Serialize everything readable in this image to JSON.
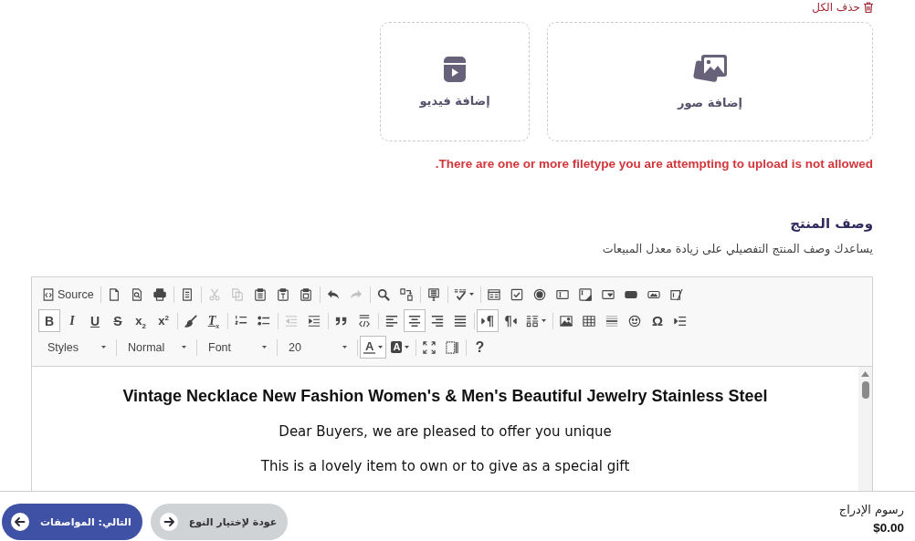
{
  "delete_all": {
    "label": "حذف الكل"
  },
  "upload": {
    "tiles": [
      {
        "kind": "images",
        "label": "إضافة صور"
      },
      {
        "kind": "video",
        "label": "إضافة فيديو"
      }
    ],
    "error": "There are one or more filetype you are attempting to upload is not allowed."
  },
  "description": {
    "title": "وصف المنتج",
    "hint": "يساعدك وصف المنتج التفصيلي على زيادة معدل المبيعات"
  },
  "editor": {
    "toolbar": [
      [
        [
          {
            "kind": "icon",
            "on": false,
            "disabled": false
          },
          {
            "kind": "icon",
            "on": false,
            "disabled": false
          },
          {
            "kind": "icon",
            "on": false,
            "disabled": false
          },
          {
            "kind": "icon",
            "on": false,
            "disabled": false
          },
          {
            "kind": "icon",
            "on": false,
            "disabled": false
          },
          {
            "kind": "icon",
            "on": false,
            "disabled": false
          },
          {
            "kind": "icon",
            "on": false,
            "disabled": false
          },
          {
            "kind": "icon",
            "on": false,
            "disabled": false
          },
          {
            "kind": "icon",
            "on": false,
            "disabled": false
          }
        ],
        [
          {
            "kind": "menu",
            "on": false,
            "disabled": false
          }
        ],
        [
          {
            "kind": "icon",
            "on": false,
            "disabled": false
          }
        ],
        [
          {
            "kind": "icon",
            "on": false,
            "disabled": false
          },
          {
            "kind": "icon",
            "on": false,
            "disabled": false
          }
        ],
        [
          {
            "kind": "icon",
            "on": false,
            "disabled": true
          },
          {
            "kind": "icon",
            "on": false,
            "disabled": false
          }
        ],
        [
          {
            "kind": "icon",
            "on": false,
            "disabled": false
          },
          {
            "kind": "icon",
            "on": false,
            "disabled": false
          },
          {
            "kind": "icon",
            "on": false,
            "disabled": false
          },
          {
            "kind": "icon",
            "on": false,
            "disabled": true
          },
          {
            "kind": "icon",
            "on": false,
            "disabled": true
          }
        ],
        [
          {
            "kind": "icon",
            "on": false,
            "disabled": false
          }
        ],
        [
          {
            "kind": "icon",
            "on": false,
            "disabled": false
          },
          {
            "kind": "icon",
            "on": false,
            "disabled": false
          },
          {
            "kind": "icon",
            "on": false,
            "disabled": false
          }
        ],
        [
          {
            "kind": "labeled",
            "label": "Source",
            "on": false,
            "disabled": false
          }
        ]
      ],
      [
        [
          {
            "kind": "icon",
            "on": false,
            "disabled": false
          },
          {
            "kind": "text",
            "label": "Ω",
            "on": false,
            "disabled": false
          },
          {
            "kind": "icon",
            "on": false,
            "disabled": false
          },
          {
            "kind": "icon",
            "on": false,
            "disabled": false
          },
          {
            "kind": "icon",
            "on": false,
            "disabled": false
          },
          {
            "kind": "icon",
            "on": false,
            "disabled": false
          }
        ],
        [
          {
            "kind": "menu",
            "on": false,
            "disabled": false
          },
          {
            "kind": "icon",
            "on": false,
            "disabled": false
          },
          {
            "kind": "icon",
            "on": true,
            "disabled": false
          }
        ],
        [
          {
            "kind": "icon",
            "on": false,
            "disabled": false
          },
          {
            "kind": "icon",
            "on": false,
            "disabled": false
          },
          {
            "kind": "icon",
            "on": true,
            "disabled": false
          },
          {
            "kind": "icon",
            "on": false,
            "disabled": false
          }
        ],
        [
          {
            "kind": "icon",
            "on": false,
            "disabled": false
          },
          {
            "kind": "icon",
            "on": false,
            "disabled": false
          }
        ],
        [
          {
            "kind": "icon",
            "on": false,
            "disabled": false
          },
          {
            "kind": "icon",
            "on": false,
            "disabled": true
          }
        ],
        [
          {
            "kind": "icon",
            "on": false,
            "disabled": false
          },
          {
            "kind": "icon",
            "on": false,
            "disabled": false
          }
        ],
        [
          {
            "kind": "text",
            "label": "T$_{x}$",
            "on": false,
            "disabled": false
          },
          {
            "kind": "icon",
            "on": false,
            "disabled": false
          }
        ],
        [
          {
            "kind": "text",
            "label": "x$^{2}$",
            "on": false,
            "disabled": false
          },
          {
            "kind": "text",
            "label": "x$_{2}$",
            "on": false,
            "disabled": false
          },
          {
            "kind": "text",
            "label": "S",
            "on": false,
            "disabled": false
          },
          {
            "kind": "text",
            "label": "U",
            "on": false,
            "disabled": false
          },
          {
            "kind": "text",
            "label": "I",
            "on": false,
            "disabled": false
          },
          {
            "kind": "text",
            "label": "B",
            "on": true,
            "disabled": false
          }
        ]
      ],
      [
        [
          {
            "kind": "text",
            "label": "?",
            "on": false,
            "disabled": false
          }
        ],
        [
          {
            "kind": "icon",
            "on": false,
            "disabled": false
          },
          {
            "kind": "icon",
            "on": false,
            "disabled": false
          }
        ],
        [
          {
            "kind": "backcolor",
            "label": "A",
            "on": false,
            "disabled": false
          },
          {
            "kind": "forecolor",
            "label": "A",
            "on": true,
            "disabled": false
          }
        ],
        [
          {
            "kind": "combo",
            "label": "20"
          }
        ],
        [
          {
            "kind": "combo",
            "label": "Font"
          }
        ],
        [
          {
            "kind": "combo",
            "label": "Normal"
          }
        ],
        [
          {
            "kind": "combo",
            "label": "Styles"
          }
        ]
      ]
    ],
    "content": [
      {
        "kind": "heading",
        "text": "Vintage Necklace New Fashion Women's & Men's Beautiful Jewelry Stainless Steel"
      },
      {
        "kind": "paragraph",
        "text": "Dear Buyers, we are pleased to offer you unique"
      },
      {
        "kind": "paragraph",
        "text": "This is a lovely item to own or to give as a special gift"
      }
    ]
  },
  "footer": {
    "fee": {
      "label": "رسوم الإدراج",
      "amount": "$0.00"
    },
    "buttons": [
      {
        "kind": "secondary",
        "label": "عودة لإختيار النوع"
      },
      {
        "kind": "primary",
        "label": "التالي: المواصفات"
      }
    ]
  }
}
